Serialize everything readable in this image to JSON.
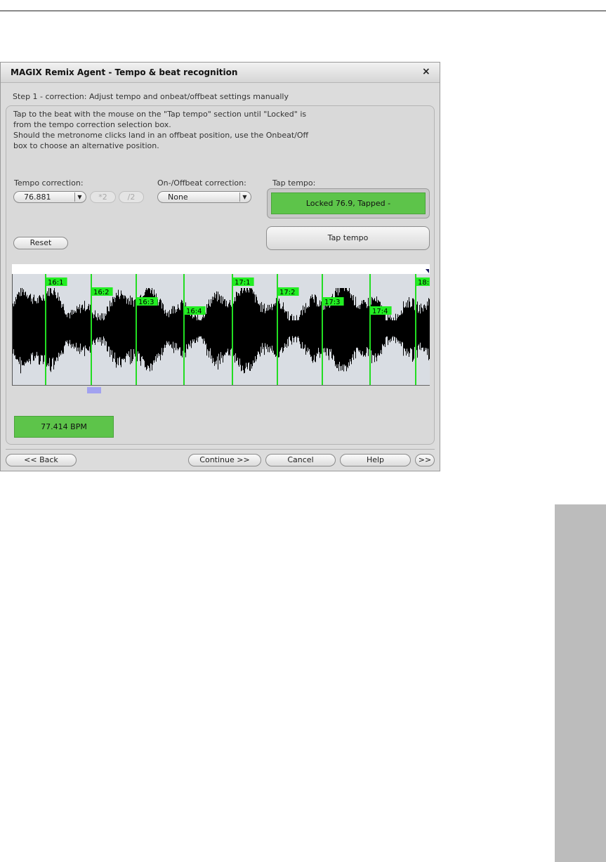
{
  "dialog": {
    "title": "MAGIX Remix Agent - Tempo & beat recognition",
    "close_glyph": "×",
    "step_label": "Step 1 - correction: Adjust tempo and onbeat/offbeat settings manually",
    "instructions": "Tap to the beat with the mouse on the \"Tap tempo\" section until \"Locked\" is\nfrom the tempo correction selection box.\nShould the metronome clicks land in an offbeat position, use the Onbeat/Off\nbox to choose an alternative position."
  },
  "tempo_correction": {
    "label": "Tempo correction:",
    "value": "76.881",
    "double_label": "*2",
    "half_label": "/2"
  },
  "offbeat_correction": {
    "label": "On-/Offbeat correction:",
    "value": "None"
  },
  "tap_tempo": {
    "label": "Tap tempo:",
    "display": "Locked 76.9, Tapped -",
    "button_label": "Tap tempo"
  },
  "reset_label": "Reset",
  "waveform": {
    "beat_markers": [
      "16:1",
      "16:2",
      "16:3",
      "16:4",
      "17:1",
      "17:2",
      "17:3",
      "17:4",
      "18:"
    ]
  },
  "bpm_display": "77.414 BPM",
  "footer": {
    "back": "<< Back",
    "continue": "Continue >>",
    "cancel": "Cancel",
    "help": "Help",
    "more": ">>"
  },
  "colors": {
    "green_display": "#5dc44a",
    "beat_line": "#22dd22",
    "marker_label": "#22ee22",
    "waveform": "#000000",
    "position_marker": "#a2a2f0"
  }
}
